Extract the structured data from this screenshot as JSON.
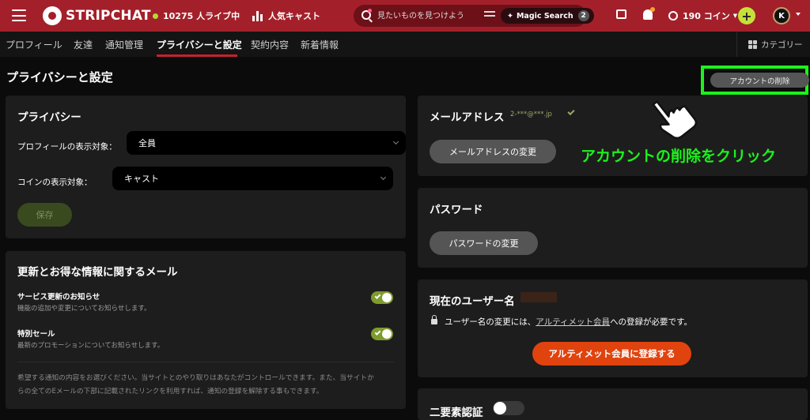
{
  "header": {
    "logo_text": "STRIPCHAT",
    "live_count": "10275 人ライブ中",
    "popular_label": "人気キャスト",
    "search_placeholder": "見たいものを見つけよう",
    "magic_search_label": "Magic Search",
    "magic_search_badge": "2",
    "coins_label": "190 コイン",
    "plus_label": "+",
    "avatar_letter": "K",
    "brand_color": "#a3202a",
    "accent_color": "#c6e03a"
  },
  "subnav": {
    "tabs": [
      {
        "label": "プロフィール"
      },
      {
        "label": "友達"
      },
      {
        "label": "通知管理"
      },
      {
        "label": "プライバシーと設定",
        "active": true
      },
      {
        "label": "契約内容"
      },
      {
        "label": "新着情報"
      }
    ],
    "category_label": "カテゴリー"
  },
  "page": {
    "title": "プライバシーと設定",
    "delete_account_label": "アカウントの削除"
  },
  "privacy": {
    "title": "プライバシー",
    "profile_visibility_label": "プロフィールの表示対象：",
    "profile_visibility_value": "全員",
    "coin_visibility_label": "コインの表示対象：",
    "coin_visibility_value": "キャスト",
    "save_label": "保存"
  },
  "emails": {
    "title": "更新とお得な情報に関するメール",
    "items": [
      {
        "title": "サービス更新のお知らせ",
        "desc": "機能の追加や変更についてお知らせします。",
        "enabled": true
      },
      {
        "title": "特別セール",
        "desc": "最新のプロモーションについてお知らせします。",
        "enabled": true
      }
    ],
    "footnote_line1": "希望する通知の内容をお選びください。当サイトとのやり取りはあなたがコントロールできます。また、当サイトか",
    "footnote_line2": "らの全てのEメールの下部に記載されたリンクを利用すれば、通知の登録を解除する事もできます。"
  },
  "email_panel": {
    "title": "メールアドレス",
    "value": "2-***@***.jp",
    "change_label": "メールアドレスの変更"
  },
  "password_panel": {
    "title": "パスワード",
    "change_label": "パスワードの変更"
  },
  "username_panel": {
    "title": "現在のユーザー名",
    "note_prefix": "ユーザー名の変更には、",
    "note_link": "アルティメット会員",
    "note_suffix": "への登録が必要です。",
    "upgrade_label": "アルティメット会員に登録する"
  },
  "twofa_panel": {
    "title": "二要素認証",
    "enabled": false
  },
  "annotation": {
    "text": "アカウントの削除をクリック",
    "color": "#1cf21c"
  },
  "icons": [
    "hamburger-icon",
    "logo-icon",
    "live-dot-icon",
    "popular-icon",
    "search-icon",
    "filter-icon",
    "sparkle-icon",
    "chat-icon",
    "bell-icon",
    "coins-icon",
    "plus-icon",
    "chevron-down-icon",
    "grid-icon",
    "check-icon",
    "lock-icon",
    "pointing-hand-icon"
  ]
}
